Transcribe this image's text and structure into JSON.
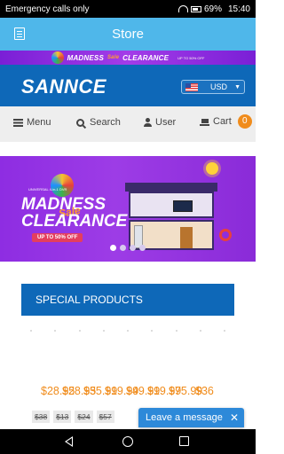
{
  "status_bar": {
    "carrier_text": "Emergency calls only",
    "battery_percent": "69%",
    "time": "15:40"
  },
  "app_bar": {
    "title": "Store"
  },
  "promo_strip": {
    "headline": "MADNESS",
    "sale_word": "Sale",
    "clearance": "CLEARANCE",
    "subtext": "UP TO 50% OFF"
  },
  "header": {
    "logo_text": "SANNCE",
    "currency": {
      "code": "USD",
      "flag": "us-flag-icon"
    }
  },
  "nav": {
    "items": [
      {
        "label": "Menu",
        "icon": "menu-icon"
      },
      {
        "label": "Search",
        "icon": "search-icon"
      },
      {
        "label": "User",
        "icon": "user-icon"
      },
      {
        "label": "Cart",
        "icon": "cart-icon"
      }
    ],
    "cart_count": "0"
  },
  "hero": {
    "small_line": "UNIVERSAL  4-in-1 DVR",
    "headline": "MADNESS",
    "sale_word": "Sale",
    "clearance": "CLEARANCE",
    "offer": "UP TO 50% OFF",
    "slides_total": 4,
    "active_slide": 1
  },
  "special_products": {
    "title": "SPECIAL PRODUCTS"
  },
  "products": {
    "prices": [
      "$28.95",
      "$28.95",
      "$35.99",
      "$19.99",
      "$49.99",
      "$19.99",
      "$75.99",
      "$36"
    ],
    "old_prices": [
      "$38",
      "$13",
      "$24",
      "$57"
    ]
  },
  "chat_widget": {
    "label": "Leave a message",
    "close": "✕"
  },
  "colors": {
    "app_bar": "#4fb7ea",
    "brand_blue": "#0e68b8",
    "promo_purple": "#8e2de2",
    "price_orange": "#f08c1c",
    "cart_badge": "#f08c1c",
    "chat_blue": "#2d89d9"
  }
}
